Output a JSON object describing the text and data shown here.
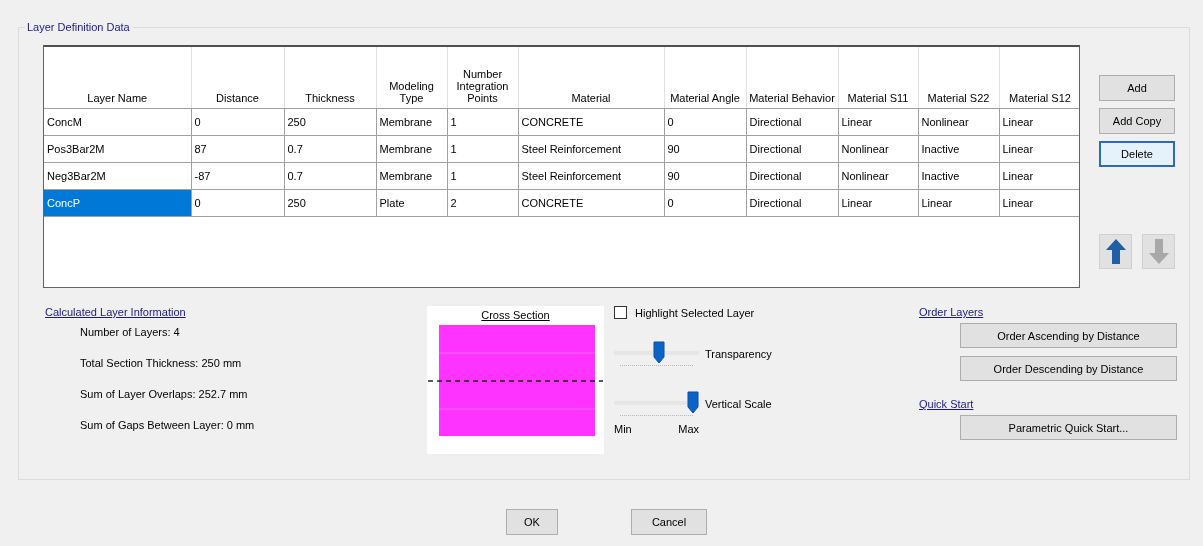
{
  "group_title": "Layer Definition Data",
  "table": {
    "columns": [
      "Layer Name",
      "Distance",
      "Thickness",
      "Modeling Type",
      "Number Integration Points",
      "Material",
      "Material Angle",
      "Material Behavior",
      "Material S11",
      "Material S22",
      "Material S12"
    ],
    "rows": [
      {
        "selected": false,
        "cells": [
          "ConcM",
          "0",
          "250",
          "Membrane",
          "1",
          "CONCRETE",
          "0",
          "Directional",
          "Linear",
          "Nonlinear",
          "Linear"
        ]
      },
      {
        "selected": false,
        "cells": [
          "Pos3Bar2M",
          "87",
          "0.7",
          "Membrane",
          "1",
          "Steel Reinforcement",
          "90",
          "Directional",
          "Nonlinear",
          "Inactive",
          "Linear"
        ]
      },
      {
        "selected": false,
        "cells": [
          "Neg3Bar2M",
          "-87",
          "0.7",
          "Membrane",
          "1",
          "Steel Reinforcement",
          "90",
          "Directional",
          "Nonlinear",
          "Inactive",
          "Linear"
        ]
      },
      {
        "selected": true,
        "cells": [
          "ConcP",
          "0",
          "250",
          "Plate",
          "2",
          "CONCRETE",
          "0",
          "Directional",
          "Linear",
          "Linear",
          "Linear"
        ]
      }
    ]
  },
  "side_buttons": [
    {
      "label": "Add",
      "focused": false
    },
    {
      "label": "Add Copy",
      "focused": false
    },
    {
      "label": "Delete",
      "focused": true
    }
  ],
  "move_buttons": [
    {
      "kind": "up",
      "disabled": false
    },
    {
      "kind": "down",
      "disabled": true
    }
  ],
  "calculated": {
    "title": "Calculated Layer Information",
    "lines": [
      "Number of Layers:  4",
      "Total Section Thickness:  250 mm",
      "Sum of Layer Overlaps:  252.7 mm",
      "Sum of Gaps Between Layer:  0 mm"
    ]
  },
  "cross_section": {
    "title": "Cross Section"
  },
  "highlight": {
    "label": "Highlight Selected Layer",
    "checked": false
  },
  "sliders": [
    {
      "label": "Transparency",
      "level": 0.53
    },
    {
      "label": "Vertical Scale",
      "level": 1
    }
  ],
  "scale_labels": [
    "Min",
    "Max"
  ],
  "order": {
    "title": "Order Layers",
    "buttons": [
      "Order Ascending by Distance",
      "Order Descending by Distance"
    ]
  },
  "quick_start": {
    "title": "Quick Start",
    "buttons": [
      "Parametric Quick Start..."
    ]
  },
  "footer": [
    "OK",
    "Cancel"
  ]
}
